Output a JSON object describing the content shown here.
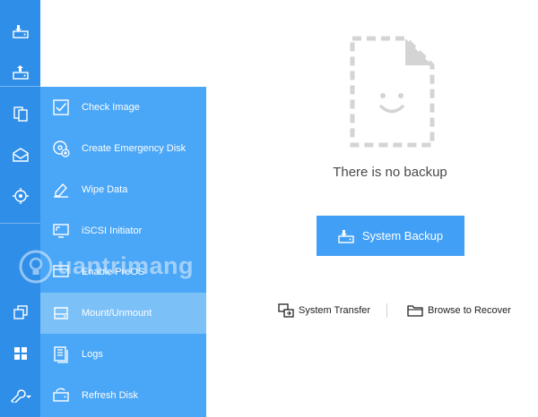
{
  "menu": {
    "items": [
      {
        "label": "Check Image",
        "icon": "check-image-icon",
        "active": false
      },
      {
        "label": "Create Emergency Disk",
        "icon": "emergency-disk-icon",
        "active": false
      },
      {
        "label": "Wipe Data",
        "icon": "eraser-icon",
        "active": false
      },
      {
        "label": "iSCSI Initiator",
        "icon": "monitor-icon",
        "active": false
      },
      {
        "label": "Enable PreOS",
        "icon": "preos-icon",
        "active": false
      },
      {
        "label": "Mount/Unmount",
        "icon": "drive-icon",
        "active": true
      },
      {
        "label": "Logs",
        "icon": "logs-icon",
        "active": false
      },
      {
        "label": "Refresh Disk",
        "icon": "refresh-disk-icon",
        "active": false
      }
    ]
  },
  "main": {
    "empty_text": "There is no backup",
    "backup_button": "System Backup",
    "transfer_link": "System Transfer",
    "recover_link": "Browse to Recover"
  },
  "watermark": {
    "text": "uantrimang"
  },
  "colors": {
    "rail": "#2f8ee8",
    "flyout": "#4aa6f6",
    "active_item": "#7cc0f8",
    "primary_button": "#41a0f5",
    "placeholder_gray": "#d4d4d4"
  }
}
